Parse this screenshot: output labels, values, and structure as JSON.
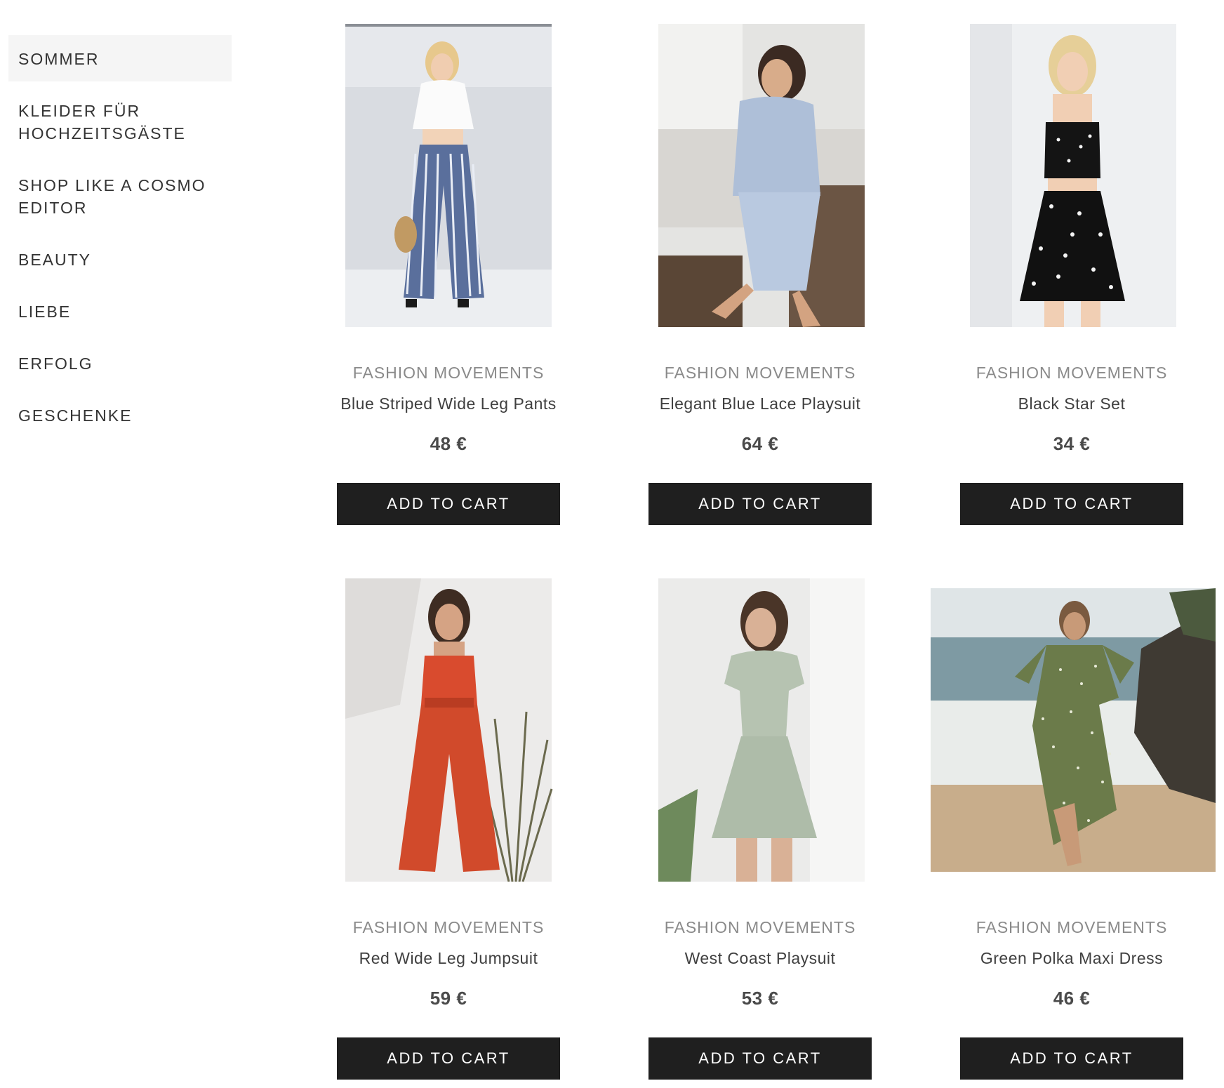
{
  "sidebar": {
    "items": [
      {
        "label": "SOMMER"
      },
      {
        "label": "KLEIDER FÜR HOCHZEITSGÄSTE"
      },
      {
        "label": "SHOP LIKE A COSMO EDITOR"
      },
      {
        "label": "BEAUTY"
      },
      {
        "label": "LIEBE"
      },
      {
        "label": "ERFOLG"
      },
      {
        "label": "GESCHENKE"
      }
    ]
  },
  "products": [
    {
      "brand": "FASHION MOVEMENTS",
      "name": "Blue Striped Wide Leg Pants",
      "price": "48 €",
      "cta": "ADD TO CART"
    },
    {
      "brand": "FASHION MOVEMENTS",
      "name": "Elegant Blue Lace Playsuit",
      "price": "64 €",
      "cta": "ADD TO CART"
    },
    {
      "brand": "FASHION MOVEMENTS",
      "name": "Black Star Set",
      "price": "34 €",
      "cta": "ADD TO CART"
    },
    {
      "brand": "FASHION MOVEMENTS",
      "name": "Red Wide Leg Jumpsuit",
      "price": "59 €",
      "cta": "ADD TO CART"
    },
    {
      "brand": "FASHION MOVEMENTS",
      "name": "West Coast Playsuit",
      "price": "53 €",
      "cta": "ADD TO CART"
    },
    {
      "brand": "FASHION MOVEMENTS",
      "name": "Green Polka Maxi Dress",
      "price": "46 €",
      "cta": "ADD TO CART"
    }
  ],
  "colors": {
    "button_bg": "#1f1f1f",
    "brand_text": "#8a8a8a",
    "active_nav_bg": "#f5f5f5"
  }
}
